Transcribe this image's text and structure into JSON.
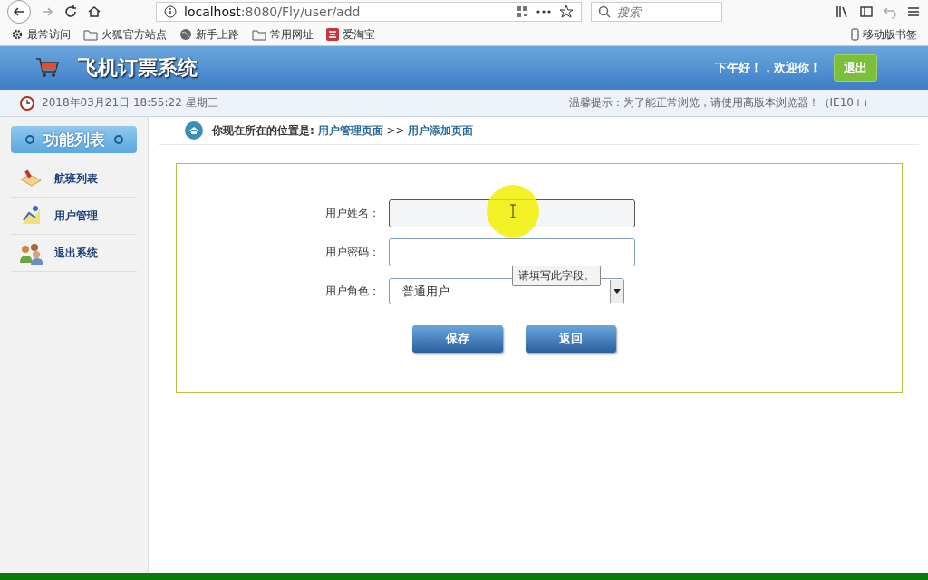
{
  "browser": {
    "url_host": "localhost",
    "url_path": ":8080/Fly/user/add",
    "search_placeholder": "搜索",
    "bookmarks": [
      {
        "label": "最常访问",
        "kind": "gear"
      },
      {
        "label": "火狐官方站点",
        "kind": "folder"
      },
      {
        "label": "新手上路",
        "kind": "globe"
      },
      {
        "label": "常用网址",
        "kind": "folder"
      },
      {
        "label": "爱淘宝",
        "kind": "tao"
      }
    ],
    "mobile_bookmarks": "移动版书签"
  },
  "header": {
    "title": "飞机订票系统",
    "greeting": "下午好！，欢迎你！",
    "logout": "退出"
  },
  "info_bar": {
    "datetime": "2018年03月21日 18:55:22 星期三",
    "notice": "温馨提示：为了能正常浏览，请使用高版本浏览器！（IE10+）"
  },
  "sidebar": {
    "title": "功能列表",
    "items": [
      {
        "label": "航班列表",
        "kind": "flight"
      },
      {
        "label": "用户管理",
        "kind": "users"
      },
      {
        "label": "退出系统",
        "kind": "exit"
      }
    ]
  },
  "breadcrumb": {
    "prefix": "你现在所在的位置是:",
    "parent": "用户管理页面",
    "separator": ">>",
    "current": "用户添加页面"
  },
  "form": {
    "fields": [
      {
        "label": "用户姓名：",
        "kind": "text"
      },
      {
        "label": "用户密码：",
        "kind": "text"
      },
      {
        "label": "用户角色：",
        "kind": "select",
        "value": "普通用户"
      }
    ],
    "tooltip": "请填写此字段。",
    "buttons": [
      "保存",
      "返回"
    ]
  }
}
